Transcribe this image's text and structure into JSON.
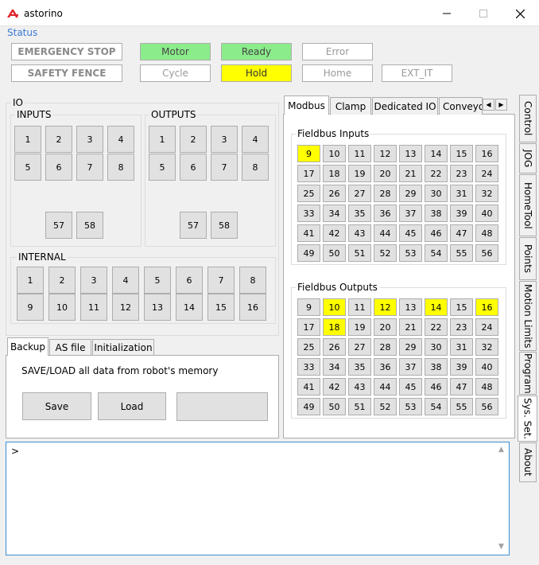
{
  "window": {
    "title": "astorino",
    "min_icon": "minimize-icon",
    "max_icon": "maximize-icon",
    "close_icon": "close-icon"
  },
  "status": {
    "label": "Status",
    "buttons": [
      {
        "label": "EMERGENCY STOP",
        "state": "inactive"
      },
      {
        "label": "Motor",
        "state": "green"
      },
      {
        "label": "Ready",
        "state": "green"
      },
      {
        "label": "Error",
        "state": "inactive"
      },
      {
        "label": "SAFETY FENCE",
        "state": "inactive"
      },
      {
        "label": "Cycle",
        "state": "inactive"
      },
      {
        "label": "Hold",
        "state": "yellow"
      },
      {
        "label": "Home",
        "state": "inactive"
      },
      {
        "label": "EXT_IT",
        "state": "inactive"
      }
    ],
    "colors": {
      "green": "#8bec8b",
      "yellow": "#ffff00"
    }
  },
  "io": {
    "title": "IO",
    "inputs": {
      "title": "INPUTS",
      "buttons": [
        "1",
        "2",
        "3",
        "4",
        "5",
        "6",
        "7",
        "8",
        "57",
        "58"
      ]
    },
    "outputs": {
      "title": "OUTPUTS",
      "buttons": [
        "1",
        "2",
        "3",
        "4",
        "5",
        "6",
        "7",
        "8",
        "57",
        "58"
      ]
    },
    "internal": {
      "title": "INTERNAL",
      "buttons": [
        "1",
        "2",
        "3",
        "4",
        "5",
        "6",
        "7",
        "8",
        "9",
        "10",
        "11",
        "12",
        "13",
        "14",
        "15",
        "16"
      ]
    }
  },
  "sys_tabs": {
    "tabs": [
      "Backup",
      "AS file",
      "Initialization"
    ],
    "active": "Backup",
    "description": "SAVE/LOAD all data from robot's memory",
    "save_label": "Save",
    "load_label": "Load",
    "third_label": ""
  },
  "fieldbus": {
    "tabs": [
      "Modbus",
      "Clamp",
      "Dedicated IO",
      "Conveyo"
    ],
    "active_tab": "Modbus",
    "inputs_title": "Fieldbus Inputs",
    "outputs_title": "Fieldbus Outputs",
    "inputs": [
      "9",
      "10",
      "11",
      "12",
      "13",
      "14",
      "15",
      "16",
      "17",
      "18",
      "19",
      "20",
      "21",
      "22",
      "23",
      "24",
      "25",
      "26",
      "27",
      "28",
      "29",
      "30",
      "31",
      "32",
      "33",
      "34",
      "35",
      "36",
      "37",
      "38",
      "39",
      "40",
      "41",
      "42",
      "43",
      "44",
      "45",
      "46",
      "47",
      "48",
      "49",
      "50",
      "51",
      "52",
      "53",
      "54",
      "55",
      "56"
    ],
    "inputs_on": [
      "9"
    ],
    "outputs": [
      "9",
      "10",
      "11",
      "12",
      "13",
      "14",
      "15",
      "16",
      "17",
      "18",
      "19",
      "20",
      "21",
      "22",
      "23",
      "24",
      "25",
      "26",
      "27",
      "28",
      "29",
      "30",
      "31",
      "32",
      "33",
      "34",
      "35",
      "36",
      "37",
      "38",
      "39",
      "40",
      "41",
      "42",
      "43",
      "44",
      "45",
      "46",
      "47",
      "48",
      "49",
      "50",
      "51",
      "52",
      "53",
      "54",
      "55",
      "56"
    ],
    "outputs_on": [
      "10",
      "12",
      "14",
      "16",
      "18"
    ],
    "highlight_color": "#ffff00"
  },
  "side_tabs": [
    "Control",
    "JOG",
    "HomeTool",
    "Points",
    "Motion Limits",
    "Program",
    "Sys. Set.",
    "About"
  ],
  "side_tabs_active": "Sys. Set.",
  "console": {
    "prompt": ">"
  }
}
